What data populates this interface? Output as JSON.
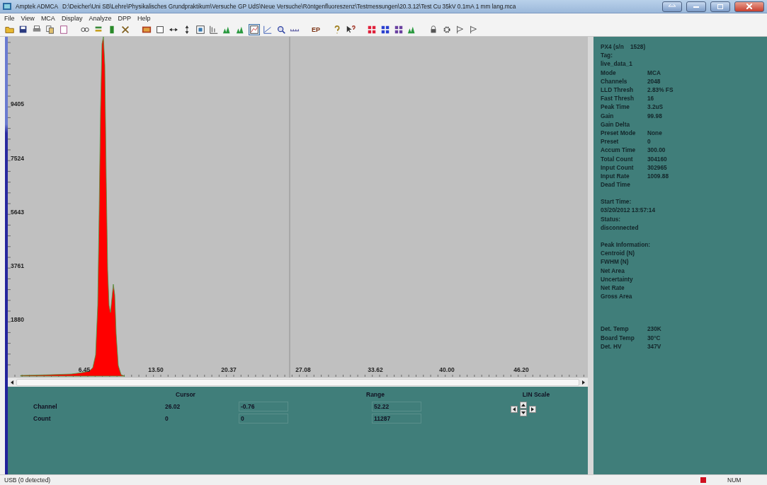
{
  "window": {
    "app": "Amptek ADMCA",
    "path": "D:\\Deicher\\Uni SB\\Lehre\\Physikalisches Grundpraktikum\\Versuche GP UdS\\Neue Versuche\\Röntgenfluoreszenz\\Testmessungen\\20.3.12\\Test Cu 35kV 0.1mA 1 mm lang.mca"
  },
  "menu": [
    "File",
    "View",
    "MCA",
    "Display",
    "Analyze",
    "DPP",
    "Help"
  ],
  "toolbar": [
    {
      "kind": "folder",
      "selected": false
    },
    {
      "kind": "disk",
      "selected": false
    },
    {
      "kind": "printer",
      "selected": false
    },
    {
      "kind": "copy",
      "selected": false
    },
    {
      "kind": "page",
      "selected": false
    },
    {
      "kind": "gap"
    },
    {
      "kind": "link",
      "selected": false
    },
    {
      "kind": "stack",
      "selected": false
    },
    {
      "kind": "battery",
      "selected": false
    },
    {
      "kind": "spark",
      "selected": false
    },
    {
      "kind": "gap"
    },
    {
      "kind": "picture",
      "selected": false
    },
    {
      "kind": "square",
      "selected": false
    },
    {
      "kind": "hsplit",
      "selected": false
    },
    {
      "kind": "vsplit",
      "selected": false
    },
    {
      "kind": "zoombox",
      "selected": false
    },
    {
      "kind": "frame",
      "selected": false
    },
    {
      "kind": "peaks",
      "selected": false
    },
    {
      "kind": "peaks",
      "selected": false
    },
    {
      "kind": "plotbox",
      "selected": true
    },
    {
      "kind": "axes",
      "selected": false
    },
    {
      "kind": "magnifier",
      "selected": false
    },
    {
      "kind": "ruler",
      "selected": false
    },
    {
      "kind": "gap"
    },
    {
      "kind": "label",
      "label": "EP",
      "selected": false
    },
    {
      "kind": "gap"
    },
    {
      "kind": "help",
      "selected": false
    },
    {
      "kind": "helpcursor",
      "selected": false
    },
    {
      "kind": "gap"
    },
    {
      "kind": "grid",
      "color": "#e0203a",
      "selected": false
    },
    {
      "kind": "grid",
      "color": "#2a40d0",
      "selected": false
    },
    {
      "kind": "grid",
      "color": "#6a40a0",
      "selected": false
    },
    {
      "kind": "peaks",
      "selected": false
    },
    {
      "kind": "gap"
    },
    {
      "kind": "lock",
      "selected": false
    },
    {
      "kind": "gear",
      "selected": false
    },
    {
      "kind": "flag",
      "selected": false
    },
    {
      "kind": "flag",
      "selected": false
    }
  ],
  "chart": {
    "y_labels": [
      "9405",
      "7524",
      "5643",
      "3761",
      "1880"
    ],
    "x_labels": [
      "6.45",
      "13.50",
      "20.37",
      "27.08",
      "33.62",
      "40.00",
      "46.20"
    ]
  },
  "readout": {
    "headers": [
      "Cursor",
      "Range",
      "LIN Scale"
    ],
    "rows": [
      {
        "label": "Channel",
        "cursor": "26.02",
        "range_low": "-0.76",
        "range_high": "52.22"
      },
      {
        "label": "Count",
        "cursor": "0",
        "range_low": "0",
        "range_high": "11287"
      }
    ]
  },
  "info_panel": {
    "sections": [
      {
        "rows": [
          {
            "label": "PX4 (s/n    1528)"
          },
          {
            "label": "Tag:"
          },
          {
            "label": "live_data_1"
          },
          {
            "label": "Mode",
            "value": "MCA"
          },
          {
            "label": "Channels",
            "value": "2048"
          },
          {
            "label": "LLD Thresh",
            "value": "2.83% FS"
          },
          {
            "label": "Fast Thresh",
            "value": "16"
          },
          {
            "label": "Peak Time",
            "value": "3.2uS"
          },
          {
            "label": "Gain",
            "value": "99.98"
          },
          {
            "label": "Gain Delta"
          },
          {
            "label": "Preset Mode",
            "value": "None"
          },
          {
            "label": "Preset",
            "value": "0"
          },
          {
            "label": "Accum Time",
            "value": "300.00"
          },
          {
            "label": "Total Count",
            "value": "304160"
          },
          {
            "label": "Input Count",
            "value": "302965"
          },
          {
            "label": "Input Rate",
            "value": "1009.88"
          },
          {
            "label": "Dead Time"
          }
        ]
      },
      {
        "rows": [
          {
            "label": "Start Time:"
          },
          {
            "label": "03/20/2012 13:57:14"
          },
          {
            "label": "Status:"
          },
          {
            "label": "disconnected"
          }
        ]
      },
      {
        "rows": [
          {
            "label": "Peak Information:"
          },
          {
            "label": "Centroid (N)"
          },
          {
            "label": "FWHM (N)"
          },
          {
            "label": "Net Area"
          },
          {
            "label": "Uncertainty"
          },
          {
            "label": "Net Rate"
          },
          {
            "label": "Gross Area"
          }
        ]
      },
      {
        "rows": [
          {
            "label": "Det. Temp",
            "value": "230K"
          },
          {
            "label": "Board Temp",
            "value": "30°C"
          },
          {
            "label": "Det. HV",
            "value": "347V"
          }
        ]
      }
    ]
  },
  "status_bar": {
    "text": "USB (0 detected)",
    "num": "NUM"
  }
}
